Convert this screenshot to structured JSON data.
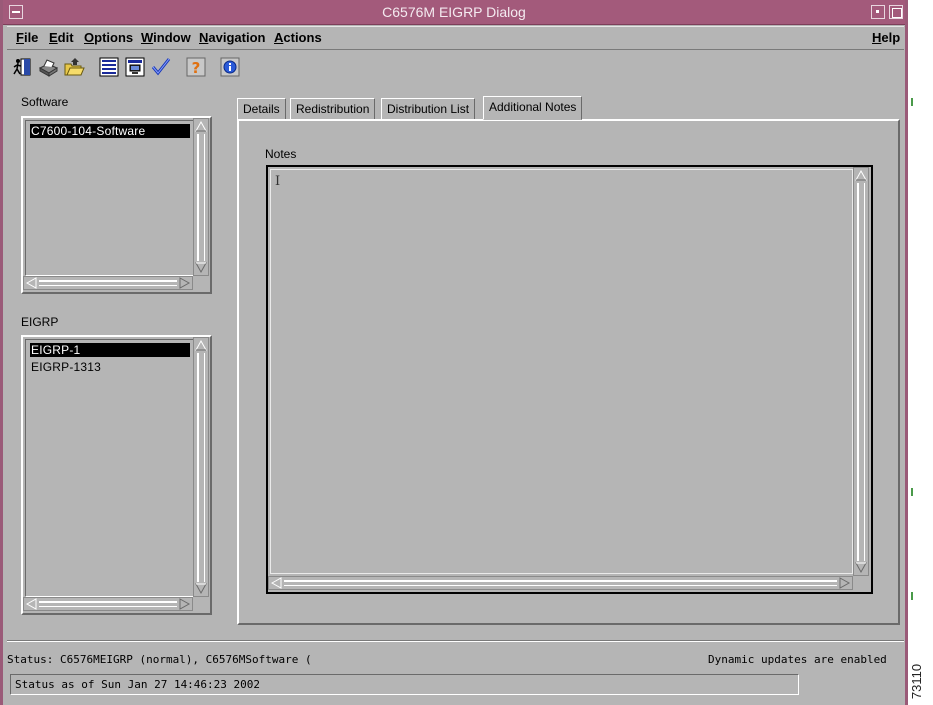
{
  "window": {
    "title": "C6576M EIGRP Dialog"
  },
  "menubar": {
    "items": [
      {
        "label": "File",
        "underline": "F",
        "rest": "ile"
      },
      {
        "label": "Edit",
        "underline": "E",
        "rest": "dit"
      },
      {
        "label": "Options",
        "underline": "O",
        "rest": "ptions"
      },
      {
        "label": "Window",
        "underline": "W",
        "rest": "indow"
      },
      {
        "label": "Navigation",
        "underline": "N",
        "rest": "avigation"
      },
      {
        "label": "Actions",
        "underline": "A",
        "rest": "ctions"
      }
    ],
    "help": {
      "label": "Help",
      "underline": "H",
      "rest": "elp"
    }
  },
  "toolbar": {
    "icons": [
      "exit-icon",
      "print-icon",
      "open-folder-icon",
      "list-icon",
      "monitor-icon",
      "checkmark-icon",
      "help-question-icon",
      "info-icon"
    ]
  },
  "software": {
    "label": "Software",
    "items": [
      {
        "text": "C7600-104-Software",
        "selected": true
      }
    ]
  },
  "eigrp": {
    "label": "EIGRP",
    "items": [
      {
        "text": "EIGRP-1",
        "selected": true
      },
      {
        "text": "EIGRP-1313",
        "selected": false
      }
    ]
  },
  "tabs": [
    {
      "label": "Details",
      "active": false
    },
    {
      "label": "Redistribution",
      "active": false
    },
    {
      "label": "Distribution List",
      "active": false
    },
    {
      "label": "Additional Notes",
      "active": true
    }
  ],
  "notes": {
    "label": "Notes",
    "value": ""
  },
  "status": {
    "line": "Status: C6576MEIGRP (normal), C6576MSoftware (",
    "updates": "Dynamic updates are enabled",
    "as_of": "Status as of Sun Jan 27 14:46:23 2002"
  },
  "figure_id": "73110",
  "colors": {
    "title_bar": "#a35a7b",
    "background": "#b5b5b5",
    "selection": "#000000"
  }
}
